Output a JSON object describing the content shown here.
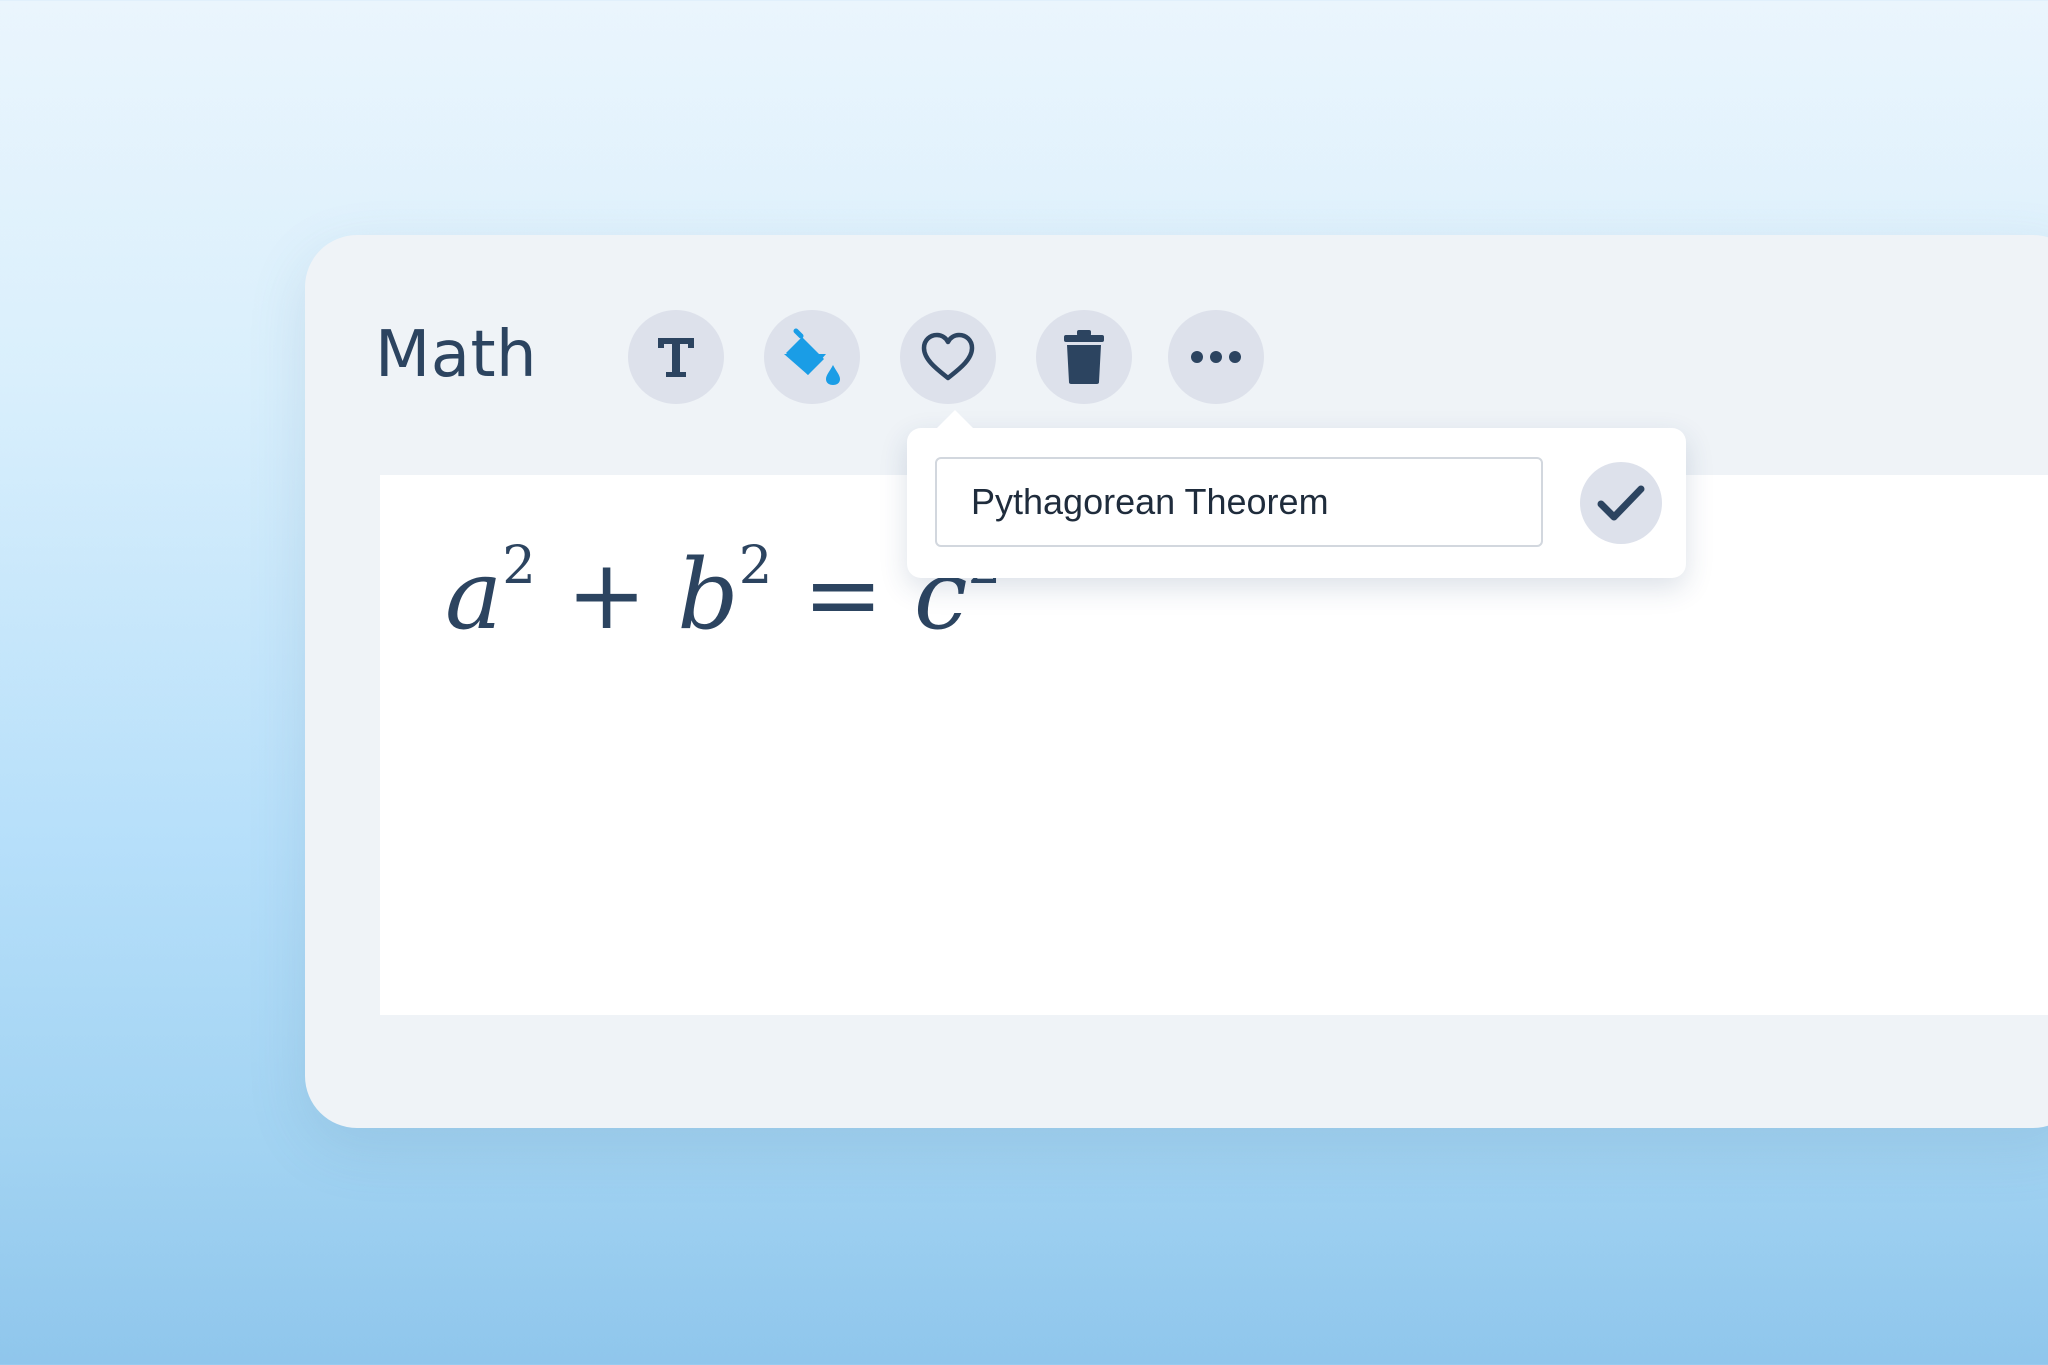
{
  "panel": {
    "title": "Math"
  },
  "toolbar": {
    "buttons": [
      {
        "name": "text",
        "icon": "text-format-icon"
      },
      {
        "name": "fill",
        "icon": "paint-bucket-icon",
        "icon_color": "#1a9de6"
      },
      {
        "name": "favorite",
        "icon": "heart-icon"
      },
      {
        "name": "delete",
        "icon": "trash-icon"
      },
      {
        "name": "more",
        "icon": "more-horizontal-icon"
      }
    ]
  },
  "editor": {
    "equation": {
      "a": "a",
      "a_exp": "2",
      "plus": "+",
      "b": "b",
      "b_exp": "2",
      "equals": "=",
      "c": "c",
      "c_exp": "2"
    }
  },
  "favorite_popup": {
    "name_value": "Pythagorean Theorem",
    "confirm_icon": "checkmark-icon"
  },
  "colors": {
    "text_primary": "#2c4460",
    "button_bg": "#dde1eb",
    "accent": "#1a9de6",
    "panel_bg": "#eff3f7"
  }
}
